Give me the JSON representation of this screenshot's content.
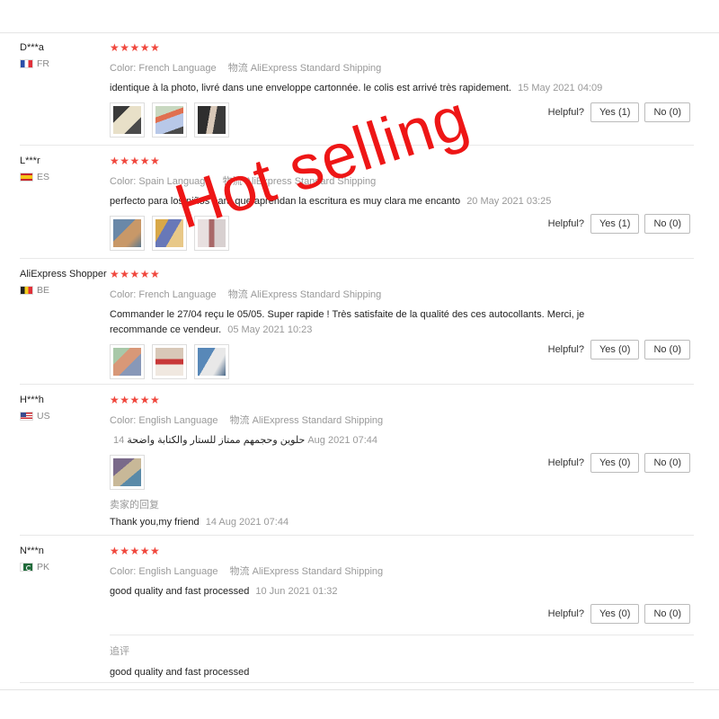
{
  "helpful_label": "Helpful?",
  "stars": "★★★★★",
  "color_label": "Color:",
  "shipping_label": "物流",
  "accent_color": "#f0483e",
  "watermark_text": "Hot selling",
  "reviews": [
    {
      "username": "D***a",
      "country": "FR",
      "color_value": "French Language",
      "shipping": "AliExpress Standard Shipping",
      "text": "identique à la photo, livré dans une enveloppe cartonnée. le colis est arrivé très rapidement.",
      "date": "15 May 2021 04:09",
      "yes": "Yes (1)",
      "no": "No (0)"
    },
    {
      "username": "L***r",
      "country": "ES",
      "color_value": "Spain Language",
      "shipping": "AliExpress Standard Shipping",
      "text": "perfecto para los niños para que aprendan la escritura es muy clara me encanto",
      "date": "20 May 2021 03:25",
      "yes": "Yes (1)",
      "no": "No (0)"
    },
    {
      "username": "AliExpress Shopper",
      "country": "BE",
      "color_value": "French Language",
      "shipping": "AliExpress Standard Shipping",
      "text": "Commander le 27/04 reçu le 05/05. Super rapide ! Très satisfaite de la qualité des ces autocollants. Merci, je recommande ce vendeur.",
      "date": "05 May 2021 10:23",
      "yes": "Yes (0)",
      "no": "No (0)"
    },
    {
      "username": "H***h",
      "country": "US",
      "color_value": "English Language",
      "shipping": "AliExpress Standard Shipping",
      "text": "حلوين وحجمهم ممتاز للستار والكتابة واضحة",
      "date": "14 Aug 2021 07:44",
      "seller_reply_label": "卖家的回复",
      "seller_reply": "Thank you,my friend",
      "seller_reply_date": "14 Aug 2021 07:44",
      "yes": "Yes (0)",
      "no": "No (0)"
    },
    {
      "username": "N***n",
      "country": "PK",
      "color_value": "English Language",
      "shipping": "AliExpress Standard Shipping",
      "text": "good quality and fast processed",
      "date": "10 Jun 2021 01:32",
      "followup_label": "追评",
      "followup_text": "good quality and fast processed",
      "yes": "Yes (0)",
      "no": "No (0)"
    }
  ]
}
